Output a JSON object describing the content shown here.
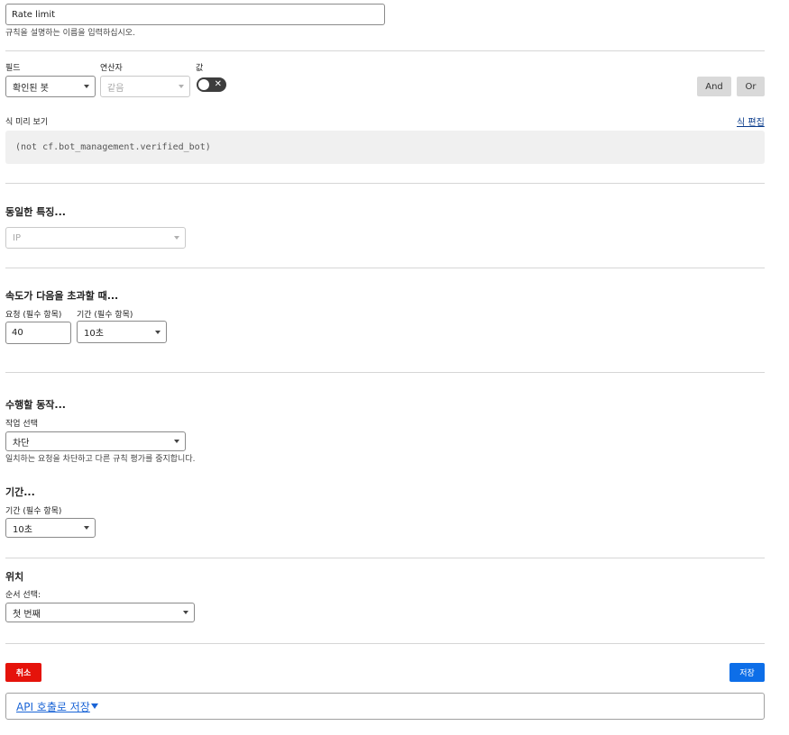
{
  "rule_name": {
    "value": "Rate limit",
    "help": "규칙을 설명하는 이름을 입력하십시오."
  },
  "expression": {
    "field_label": "필드",
    "operator_label": "연산자",
    "value_label": "값",
    "field_value": "확인된 봇",
    "operator_value": "같음",
    "and_label": "And",
    "or_label": "Or"
  },
  "preview": {
    "label": "식 미리 보기",
    "edit_link": "식 편집",
    "code": "(not cf.bot_management.verified_bot)"
  },
  "characteristics": {
    "heading": "동일한 특징...",
    "value": "IP"
  },
  "rate": {
    "heading": "속도가 다음을 초과할 때...",
    "requests_label": "요청 (필수 항목)",
    "requests_value": "40",
    "period_label": "기간 (필수 항목)",
    "period_value": "10초"
  },
  "action": {
    "heading": "수행할 동작...",
    "label": "작업 선택",
    "value": "차단",
    "help": "일치하는 요청을 차단하고 다른 규칙 평가를 중지합니다."
  },
  "duration": {
    "heading": "기간...",
    "label": "기간 (필수 항목)",
    "value": "10초"
  },
  "placement": {
    "heading": "위치",
    "label": "순서 선택:",
    "value": "첫 번째"
  },
  "footer": {
    "cancel_label": "취소",
    "save_label": "저장",
    "api_link": "API 호출로 저장"
  },
  "colors": {
    "cancel": "#e5130b",
    "save": "#0d6ee8",
    "link": "#1a64d6"
  }
}
